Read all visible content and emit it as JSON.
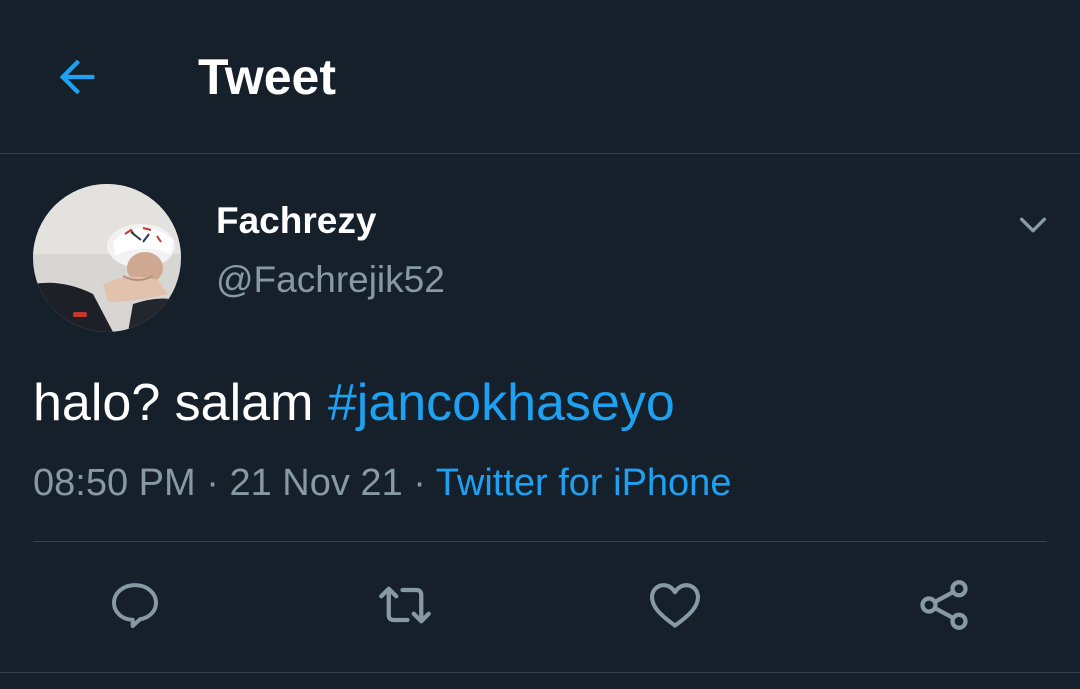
{
  "header": {
    "title": "Tweet",
    "back_icon": "arrow-left-icon"
  },
  "tweet": {
    "author": {
      "display_name": "Fachrezy",
      "handle": "@Fachrejik52"
    },
    "text": "halo? salam ",
    "hashtag": "#jancokhaseyo",
    "time": "08:50 PM",
    "sep1": " · ",
    "date": "21 Nov 21",
    "sep2": " · ",
    "source": "Twitter for iPhone"
  },
  "actions": [
    {
      "icon": "reply-icon"
    },
    {
      "icon": "retweet-icon"
    },
    {
      "icon": "like-icon"
    },
    {
      "icon": "share-icon"
    }
  ],
  "colors": {
    "background": "#15202b",
    "accent": "#1da1f2",
    "muted": "#8899a6",
    "divider": "#38444d"
  }
}
